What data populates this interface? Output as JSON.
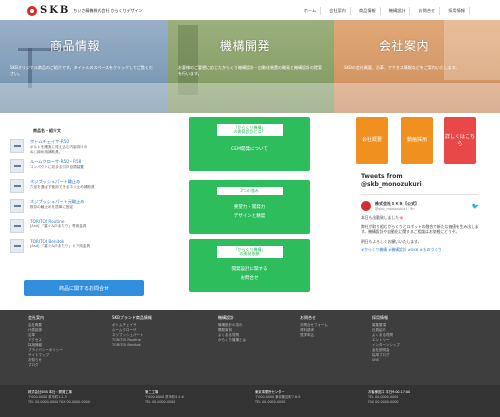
{
  "brand": {
    "logo_text": "SKB",
    "tagline": "ちいさ精機株式会社 からくりデザイン"
  },
  "nav": [
    "ホーム",
    "会社案内",
    "商品情報",
    "機構設計",
    "お問合せ",
    "採用情報"
  ],
  "hero": [
    {
      "title": "商品情報",
      "desc": "SKBオリジナル商品のご紹介です。タイトルのスペースをクリックしてご覧ください。"
    },
    {
      "title": "機構開発",
      "desc": "お客様のご要望に応じたからくり機構設計・自動化装置の開発と機構設計の提案を行います。"
    },
    {
      "title": "会社案内",
      "desc": "SKBの会社概要、沿革、アクセス情報などをご案内いたします。"
    }
  ],
  "products": {
    "title": "商品名・紹介文",
    "items": [
      {
        "name": "ボトムチェイサ-R50",
        "desc1": "ボルトを確実に咥え込む内製向けの",
        "desc2": "ねじ締め用補助具。"
      },
      {
        "name": "ルームクローザ-R50・R58",
        "desc1": "コンパクトに収まる引戸自閉装置",
        "desc2": ""
      },
      {
        "name": "ネジプッシュパート輪止め",
        "desc1": "穴径を選ばず使用できるネジ止め補助具",
        "desc2": ""
      },
      {
        "name": "ネジプッシュパート元輪止め",
        "desc1": "既存の輪止めを簡単に固定",
        "desc2": ""
      },
      {
        "name": "TORITOI Routine",
        "desc1": "[Asd] 「塞ぐ&戸あたり」専用金具",
        "desc2": ""
      },
      {
        "name": "TORITOI Benitok",
        "desc1": "[Asd] 「塞ぐ&戸あたり」ドア用金具",
        "desc2": ""
      }
    ],
    "button": "商品に関するお問合せ"
  },
  "green_boxes": [
    {
      "tag1": "「からくり機構」",
      "tag2": "の開発設計とは？",
      "lines": [
        "CEM開発について"
      ]
    },
    {
      "tag1": "3つの強み",
      "tag2": "",
      "lines": [
        "要望力・開発力",
        "デザインと精度"
      ]
    },
    {
      "tag1": "「からくり機構」",
      "tag2": "の開発依頼",
      "lines": [
        "開発設計に関する",
        "お問合せ"
      ]
    }
  ],
  "side_buttons": [
    "会社概要",
    "動画採用",
    "詳しくはこちら"
  ],
  "tweets": {
    "title_line1": "Tweets from",
    "title_line2": "@skb_monozukuri",
    "author": "株式会社ＳＫＢ【公式】",
    "handle": "@skb_monozukuri · 9h",
    "bird": "🐦",
    "text1": "本日も出勤致しました🌸",
    "text2": "弊社が取り組むからくりとロボットの融合で新たな価値を生み出します。機構設計や自動化に関するご相談はお気軽にどうぞ。",
    "text3": "明日もよろしくお願いいたします。",
    "link": "#からくり機構 #機構設計 #SKB #ものづくり"
  },
  "footer": {
    "cols": [
      {
        "head": "会社案内",
        "items": [
          "会社概要",
          "代表挨拶",
          "沿革",
          "アクセス",
          "採用情報",
          "プライバシーポリシー",
          "サイトマップ",
          "お知らせ",
          "ブログ"
        ]
      },
      {
        "head": "SKBブランド商品情報",
        "items": [
          "ボトムチェイサ",
          "ルームクローザ",
          "ネジプッシュパート",
          "TORITOI Routine",
          "TORITOI Benitok"
        ]
      },
      {
        "head": "機構設計",
        "items": [
          "機構設計の流れ",
          "開発事例",
          "よくある質問",
          "からくり機構とは"
        ]
      },
      {
        "head": "お問合せ",
        "items": [
          "お問合せフォーム",
          "資料請求",
          "見学申込"
        ]
      },
      {
        "head": "採用情報",
        "items": [
          "募集要項",
          "社員紹介",
          "よくある質問",
          "エントリー",
          "インターンシップ",
          "会社説明会",
          "採用ブログ",
          "SNS"
        ]
      }
    ],
    "addresses": [
      {
        "name": "株式会社SKB 本社・開発工場",
        "l1": "〒000-0000 県市町1-2-3",
        "l2": "TEL 00-0000-0000 FAX 00-0000-0000"
      },
      {
        "name": "第二工場",
        "l1": "〒000-0000 県市町4-5-6",
        "l2": "TEL 00-0000-0000"
      },
      {
        "name": "東京事業所センター",
        "l1": "〒000-0000 東京都区町7-8-9",
        "l2": "TEL 00-0000-0000"
      },
      {
        "name": "お客様窓口 平日9:00-17:00",
        "l1": "TEL 00-0000-0000",
        "l2": "FAX 00-0000-0000"
      }
    ]
  }
}
